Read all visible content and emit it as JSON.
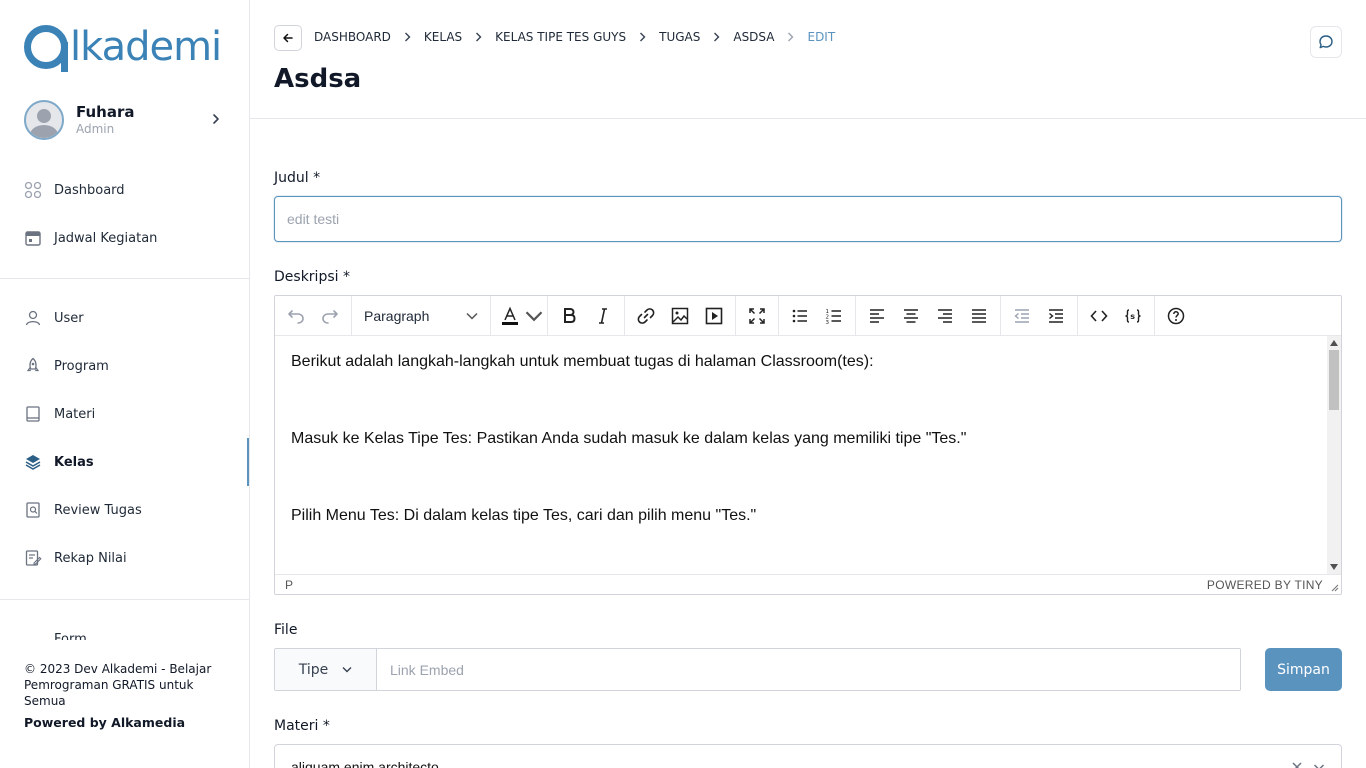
{
  "brand": {
    "logo_text": "lkademi"
  },
  "profile": {
    "name": "Fuhara",
    "role": "Admin"
  },
  "nav_top": [
    {
      "label": "Dashboard",
      "icon": "grid-icon"
    },
    {
      "label": "Jadwal Kegiatan",
      "icon": "calendar-icon"
    }
  ],
  "nav_main": [
    {
      "label": "User",
      "icon": "user-icon"
    },
    {
      "label": "Program",
      "icon": "rocket-icon"
    },
    {
      "label": "Materi",
      "icon": "book-icon"
    },
    {
      "label": "Kelas",
      "icon": "layers-icon",
      "active": true
    },
    {
      "label": "Review Tugas",
      "icon": "review-icon"
    },
    {
      "label": "Rekap Nilai",
      "icon": "edit-note-icon"
    }
  ],
  "nav_bottom_partial": "Form",
  "footer": {
    "copyright": "© 2023 Dev Alkademi - Belajar Pemrograman GRATIS untuk Semua",
    "powered": "Powered by Alkamedia"
  },
  "breadcrumb": [
    "DASHBOARD",
    "KELAS",
    "KELAS TIPE TES GUYS",
    "TUGAS",
    "ASDSA",
    "EDIT"
  ],
  "page_title": "Asdsa",
  "form": {
    "judul_label": "Judul *",
    "judul_value": "edit testi",
    "deskripsi_label": "Deskripsi *",
    "editor": {
      "block_format": "Paragraph",
      "paragraphs": [
        "Berikut adalah langkah-langkah untuk membuat tugas di halaman Classroom(tes):",
        "Masuk ke Kelas Tipe Tes: Pastikan Anda sudah masuk ke dalam kelas yang memiliki tipe \"Tes.\"",
        "Pilih Menu Tes: Di dalam kelas tipe Tes, cari dan pilih menu \"Tes.\""
      ],
      "status_path": "P",
      "powered": "POWERED BY TINY"
    },
    "file_label": "File",
    "file_type": "Tipe",
    "file_placeholder": "Link Embed",
    "save_label": "Simpan",
    "materi_label": "Materi *",
    "materi_value": "aliquam enim architecto"
  },
  "colors": {
    "accent": "#5b93bf",
    "logo": "#3b82b6"
  }
}
